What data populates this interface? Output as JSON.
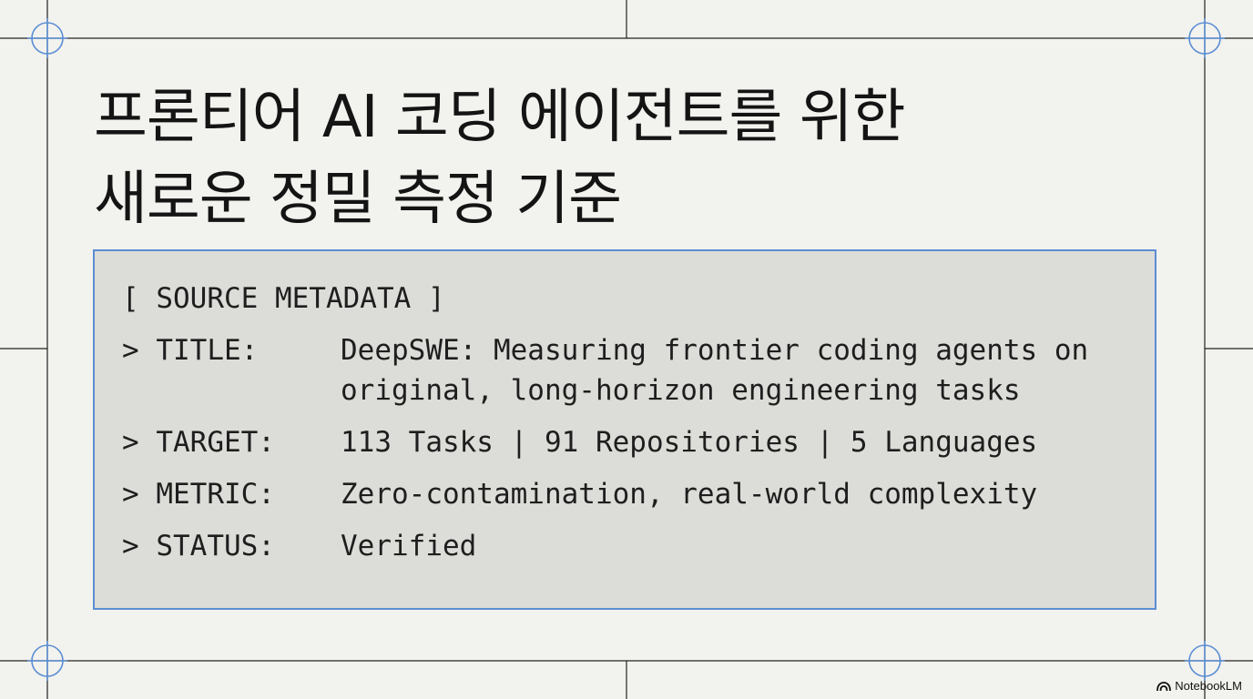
{
  "slide": {
    "title_line1": "프론티어 AI 코딩 에이전트를 위한",
    "title_line2": "새로운 정밀 측정 기준"
  },
  "metadata": {
    "header": "[ SOURCE METADATA ]",
    "title_key": "> TITLE:",
    "title_value_line1": "DeepSWE: Measuring frontier coding agents on",
    "title_value_line2": "original, long-horizon engineering tasks",
    "target_key": "> TARGET:",
    "target_value": "113 Tasks | 91 Repositories | 5 Languages",
    "metric_key": "> METRIC:",
    "metric_value": "Zero-contamination, real-world complexity",
    "status_key": "> STATUS:",
    "status_value": "Verified"
  },
  "branding": {
    "icon": "notebooklm-icon",
    "label": "NotebookLM"
  },
  "colors": {
    "background": "#f2f2ee",
    "box_fill": "#dcdcd8",
    "box_border": "#5b8ed4",
    "crosshair": "#5b8ed4",
    "grid_line": "#222222"
  }
}
